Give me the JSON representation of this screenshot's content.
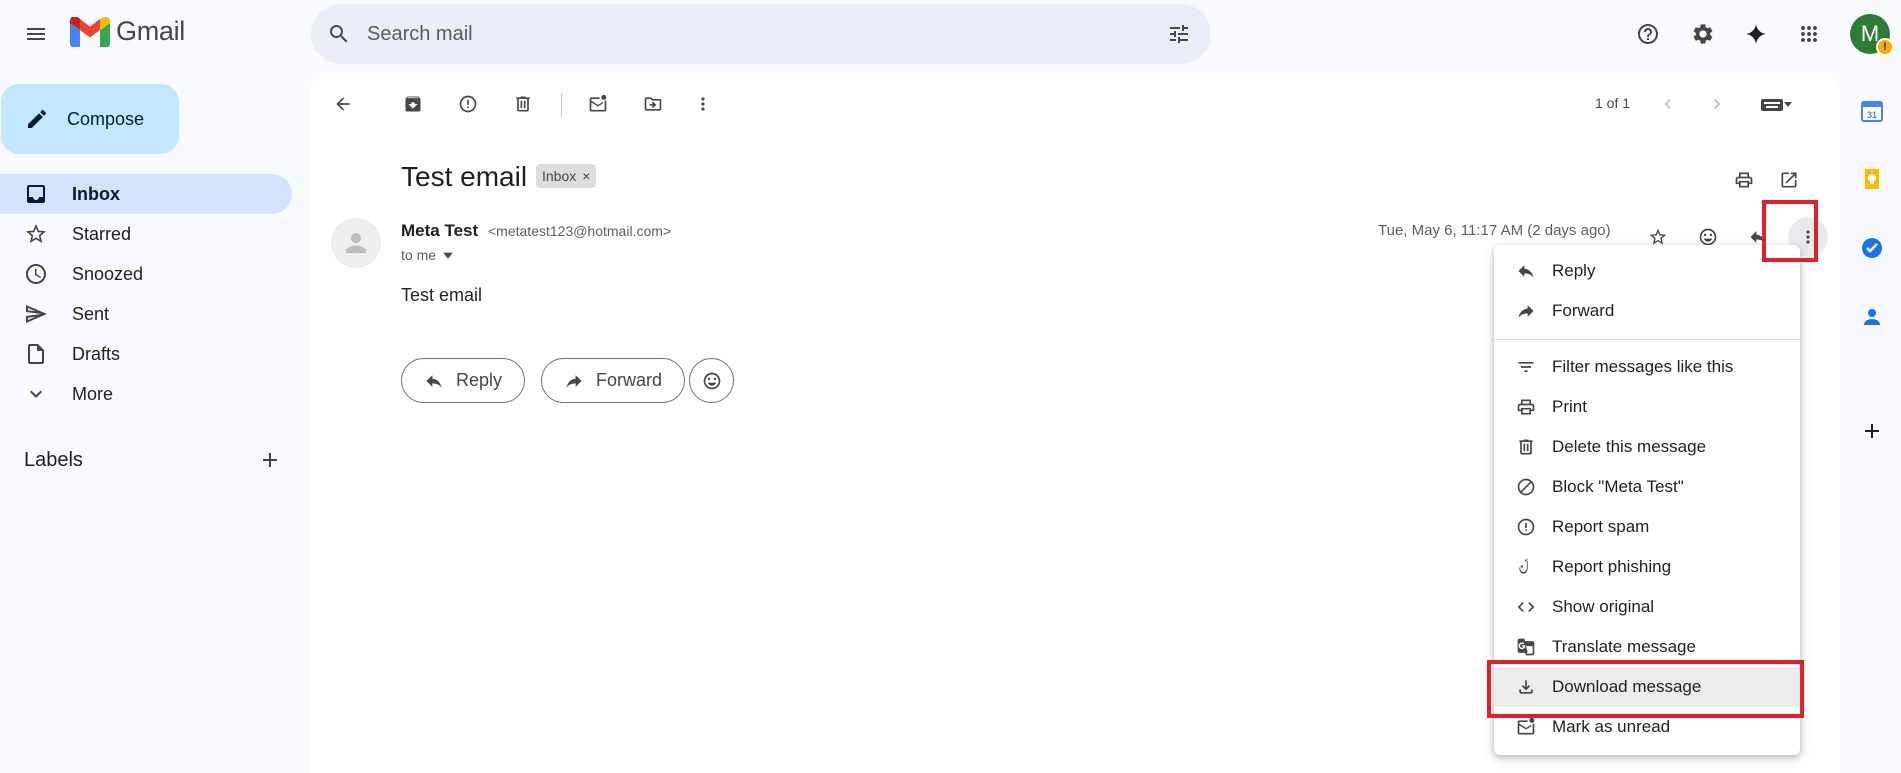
{
  "app": {
    "name": "Gmail"
  },
  "search": {
    "placeholder": "Search mail"
  },
  "compose": {
    "label": "Compose"
  },
  "sidebar": {
    "items": [
      {
        "label": "Inbox",
        "icon": "inbox-icon",
        "active": true
      },
      {
        "label": "Starred",
        "icon": "star-icon"
      },
      {
        "label": "Snoozed",
        "icon": "clock-icon"
      },
      {
        "label": "Sent",
        "icon": "send-icon"
      },
      {
        "label": "Drafts",
        "icon": "draft-icon"
      },
      {
        "label": "More",
        "icon": "chevron-down-icon"
      }
    ],
    "labels_title": "Labels"
  },
  "account": {
    "initial": "M",
    "warning": "!"
  },
  "toolbar": {
    "pager": "1 of 1"
  },
  "message": {
    "subject": "Test email",
    "label_chip": "Inbox",
    "chip_close": "×",
    "sender_name": "Meta Test",
    "sender_email": "<metatest123@hotmail.com>",
    "to": "to me",
    "date": "Tue, May 6, 11:17 AM (2 days ago)",
    "body": "Test email"
  },
  "actions": {
    "reply": "Reply",
    "forward": "Forward"
  },
  "menu": {
    "items": [
      {
        "label": "Reply",
        "icon": "reply-icon"
      },
      {
        "label": "Forward",
        "icon": "forward-icon"
      },
      {
        "label": "Filter messages like this",
        "icon": "filter-icon"
      },
      {
        "label": "Print",
        "icon": "print-icon"
      },
      {
        "label": "Delete this message",
        "icon": "trash-icon"
      },
      {
        "label": "Block \"Meta Test\"",
        "icon": "block-icon"
      },
      {
        "label": "Report spam",
        "icon": "spam-icon"
      },
      {
        "label": "Report phishing",
        "icon": "phishing-hook-icon"
      },
      {
        "label": "Show original",
        "icon": "code-icon"
      },
      {
        "label": "Translate message",
        "icon": "translate-icon"
      },
      {
        "label": "Download message",
        "icon": "download-icon",
        "highlighted": true
      },
      {
        "label": "Mark as unread",
        "icon": "mark-unread-icon"
      }
    ]
  },
  "colors": {
    "accent": "#c2e7ff",
    "active_nav": "#d3e3fd",
    "annotation_red": "#e0202a",
    "avatar": "#2e7d32"
  }
}
